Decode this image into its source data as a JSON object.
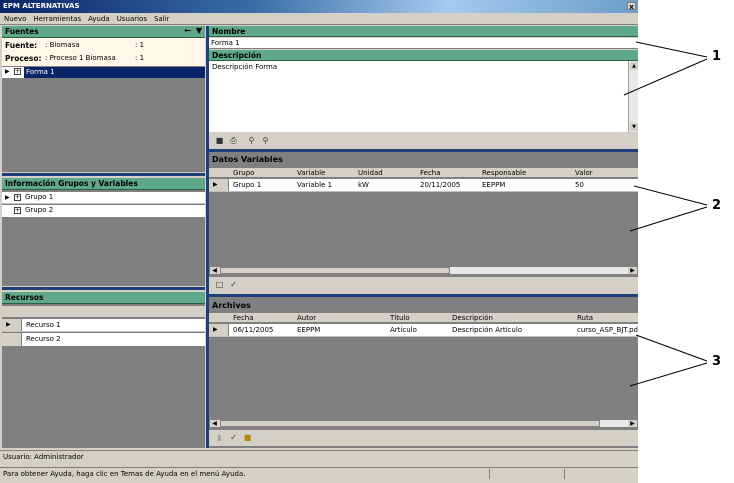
{
  "window": {
    "title": "EPM ALTERNATIVAS",
    "close_glyph": "x"
  },
  "menu": [
    "Nuevo",
    "Herramientas",
    "Ayuda",
    "Usuarios",
    "Salir"
  ],
  "fuentes": {
    "title": "Fuentes",
    "fuente_label": "Fuente:",
    "fuente_value": ": Biomasa",
    "fuente_count": ": 1",
    "proceso_label": "Proceso:",
    "proceso_value": ": Proceso 1 Biomasa",
    "proceso_count": ": 1",
    "item": "Forma 1"
  },
  "info": {
    "title": "Información Grupos y Variables",
    "items": [
      "Grupo 1",
      "Grupo 2"
    ]
  },
  "recursos": {
    "title": "Recursos",
    "items": [
      "Recurso 1",
      "Recurso 2"
    ]
  },
  "nombre": {
    "title": "Nombre",
    "value": "Forma 1"
  },
  "descripcion": {
    "title": "Descripción",
    "value": "Descripción Forma"
  },
  "datos": {
    "title": "Datos Variables",
    "columns": [
      "Grupo",
      "Variable",
      "Unidad",
      "Fecha",
      "Responsable",
      "Valor"
    ],
    "row": [
      "Grupo 1",
      "Variable 1",
      "kW",
      "20/11/2005",
      "EEPPM",
      "50"
    ]
  },
  "archivos": {
    "title": "Archivos",
    "columns": [
      "Fecha",
      "Autor",
      "Título",
      "Descripción",
      "Ruta"
    ],
    "row": [
      "06/11/2005",
      "EEPPM",
      "Artículo",
      "Descripción Artículo",
      "curso_ASP_BJT.pdf"
    ]
  },
  "status": {
    "user": "Usuario: Administrador",
    "help": "Para obtener Ayuda, haga clic en Temas de Ayuda en el menú Ayuda."
  },
  "callouts": [
    "1",
    "2",
    "3"
  ],
  "colors": {
    "panel_head": "#5fa88a",
    "selection": "#0a246a",
    "separator": "#1f3f7a"
  }
}
